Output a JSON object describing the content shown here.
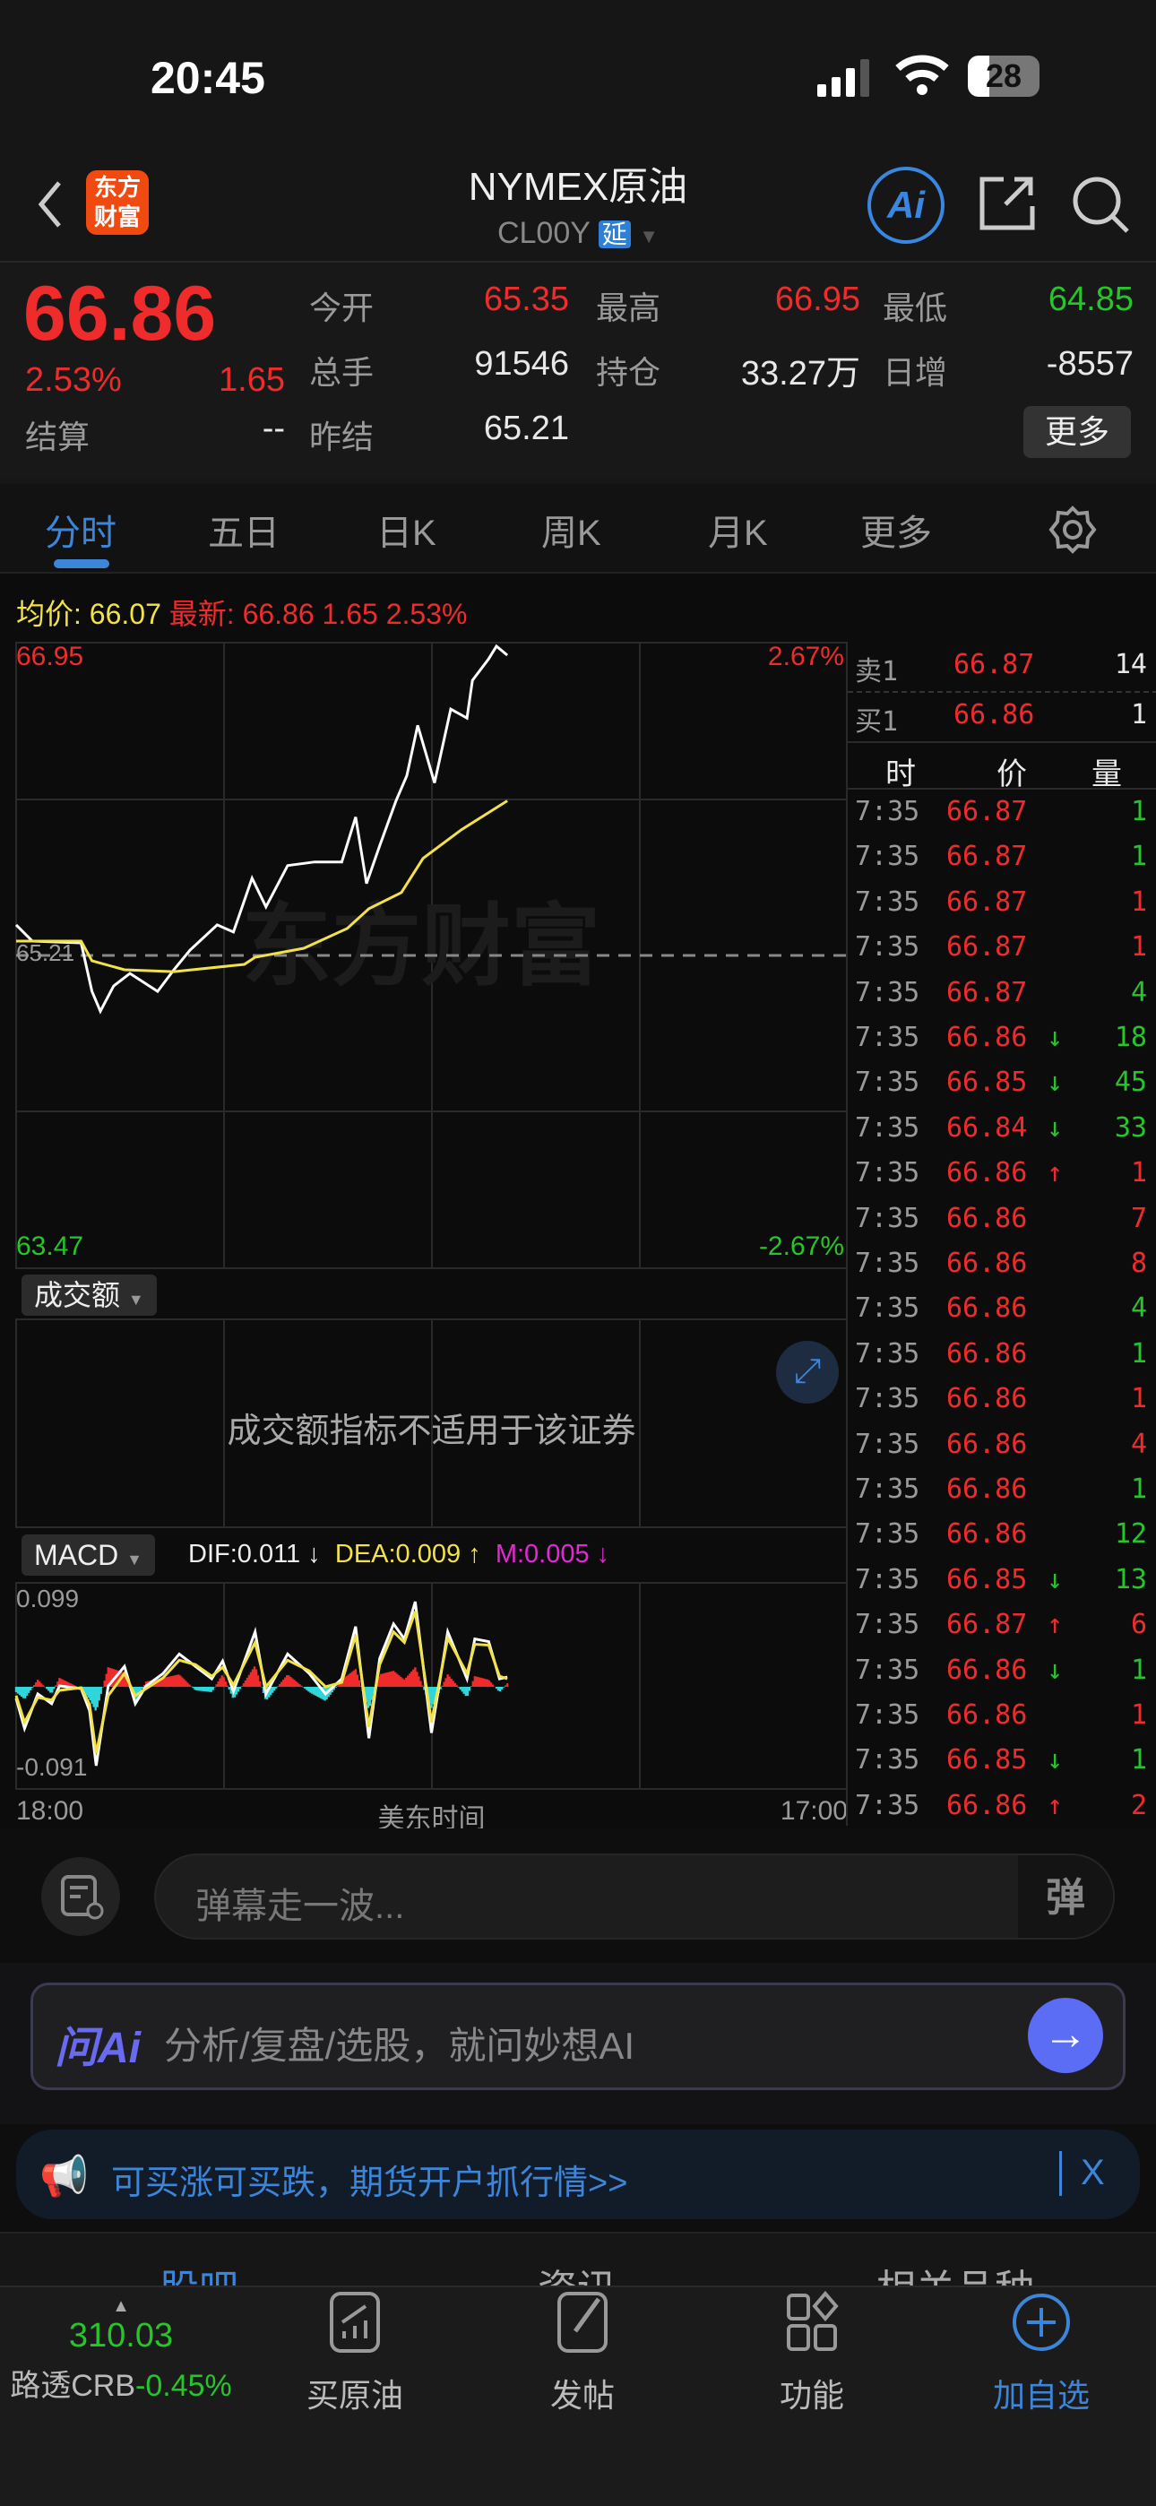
{
  "status": {
    "time": "20:45",
    "battery": "28"
  },
  "header": {
    "title": "NYMEX原油",
    "code": "CL00Y",
    "delay_badge": "延",
    "logo_text": "东方财富",
    "ai_label": "Ai"
  },
  "quote": {
    "price": "66.86",
    "change_pct": "2.53%",
    "change": "1.65",
    "fields": [
      {
        "label": "今开",
        "value": "65.35",
        "color": "red"
      },
      {
        "label": "最高",
        "value": "66.95",
        "color": "red"
      },
      {
        "label": "最低",
        "value": "64.85",
        "color": "green"
      },
      {
        "label": "总手",
        "value": "91546",
        "color": "white"
      },
      {
        "label": "持仓",
        "value": "33.27万",
        "color": "white"
      },
      {
        "label": "日增",
        "value": "-8557",
        "color": "white"
      },
      {
        "label": "结算",
        "value": "--",
        "color": "white"
      },
      {
        "label": "昨结",
        "value": "65.21",
        "color": "white"
      }
    ],
    "more_button": "更多"
  },
  "tabs": [
    "分时",
    "五日",
    "日K",
    "周K",
    "月K",
    "更多"
  ],
  "info_line": {
    "avg_label": "均价:",
    "avg": "66.07",
    "latest_label": "最新:",
    "latest": "66.86",
    "change": "1.65",
    "pct": "2.53%"
  },
  "volume_panel": {
    "selector": "成交额",
    "message": "成交额指标不适用于该证券"
  },
  "macd_panel": {
    "selector": "MACD",
    "dif": "DIF:0.011 ↓",
    "dea": "DEA:0.009 ↑",
    "m": "M:0.005 ↓"
  },
  "order_book": {
    "ask_label": "卖1",
    "ask_price": "66.87",
    "ask_vol": "14",
    "bid_label": "买1",
    "bid_price": "66.86",
    "bid_vol": "1",
    "headers": [
      "时",
      "价",
      "量"
    ]
  },
  "trades": [
    {
      "t": "7:35",
      "p": "66.87",
      "a": "",
      "v": "1",
      "vc": "g"
    },
    {
      "t": "7:35",
      "p": "66.87",
      "a": "",
      "v": "1",
      "vc": "g"
    },
    {
      "t": "7:35",
      "p": "66.87",
      "a": "",
      "v": "1",
      "vc": "r"
    },
    {
      "t": "7:35",
      "p": "66.87",
      "a": "",
      "v": "1",
      "vc": "r"
    },
    {
      "t": "7:35",
      "p": "66.87",
      "a": "",
      "v": "4",
      "vc": "g"
    },
    {
      "t": "7:35",
      "p": "66.86",
      "a": "↓",
      "v": "18",
      "vc": "g"
    },
    {
      "t": "7:35",
      "p": "66.85",
      "a": "↓",
      "v": "45",
      "vc": "g"
    },
    {
      "t": "7:35",
      "p": "66.84",
      "a": "↓",
      "v": "33",
      "vc": "g"
    },
    {
      "t": "7:35",
      "p": "66.86",
      "a": "↑",
      "v": "1",
      "vc": "r"
    },
    {
      "t": "7:35",
      "p": "66.86",
      "a": "",
      "v": "7",
      "vc": "r"
    },
    {
      "t": "7:35",
      "p": "66.86",
      "a": "",
      "v": "8",
      "vc": "r"
    },
    {
      "t": "7:35",
      "p": "66.86",
      "a": "",
      "v": "4",
      "vc": "g"
    },
    {
      "t": "7:35",
      "p": "66.86",
      "a": "",
      "v": "1",
      "vc": "g"
    },
    {
      "t": "7:35",
      "p": "66.86",
      "a": "",
      "v": "1",
      "vc": "r"
    },
    {
      "t": "7:35",
      "p": "66.86",
      "a": "",
      "v": "4",
      "vc": "r"
    },
    {
      "t": "7:35",
      "p": "66.86",
      "a": "",
      "v": "1",
      "vc": "g"
    },
    {
      "t": "7:35",
      "p": "66.86",
      "a": "",
      "v": "12",
      "vc": "g"
    },
    {
      "t": "7:35",
      "p": "66.85",
      "a": "↓",
      "v": "13",
      "vc": "g"
    },
    {
      "t": "7:35",
      "p": "66.87",
      "a": "↑",
      "v": "6",
      "vc": "r"
    },
    {
      "t": "7:35",
      "p": "66.86",
      "a": "↓",
      "v": "1",
      "vc": "g"
    },
    {
      "t": "7:35",
      "p": "66.86",
      "a": "",
      "v": "1",
      "vc": "r"
    },
    {
      "t": "7:35",
      "p": "66.85",
      "a": "↓",
      "v": "1",
      "vc": "g"
    },
    {
      "t": "7:35",
      "p": "66.86",
      "a": "↑",
      "v": "2",
      "vc": "r"
    }
  ],
  "danmaku": {
    "placeholder": "弹幕走一波...",
    "toggle": "弹"
  },
  "ai_box": {
    "brand": "问Ai",
    "placeholder": "分析/复盘/选股，就问妙想AI"
  },
  "banner": {
    "text": "可买涨可买跌，期货开户抓行情>>",
    "close": "X"
  },
  "sub_tabs": [
    "股吧",
    "资讯",
    "相关品种"
  ],
  "bottom_nav": {
    "index_value": "310.03",
    "index_name": "路透CRB",
    "index_change": "-0.45%",
    "items": [
      "买原油",
      "发帖",
      "功能",
      "加自选"
    ]
  },
  "colors": {
    "up": "#ef2b2b",
    "down": "#27c42b",
    "accent": "#3d85d8",
    "avg_line": "#f2e24a",
    "macd_m": "#e627d8"
  },
  "chart_data": [
    {
      "type": "line",
      "title": "分时",
      "xlabel": "美东时间",
      "x_ticks": [
        "18:00",
        "17:00"
      ],
      "x_range_minutes": [
        0,
        1380
      ],
      "ylim": [
        63.47,
        66.95
      ],
      "baseline": 65.21,
      "y_labels_left": [
        "66.95",
        "65.21",
        "63.47"
      ],
      "y_labels_right": [
        "2.67%",
        "-2.67%"
      ],
      "series": [
        {
          "name": "价格",
          "x": [
            0,
            27,
            108,
            126,
            140,
            162,
            189,
            235,
            262,
            289,
            334,
            361,
            392,
            415,
            451,
            496,
            541,
            564,
            582,
            604,
            631,
            649,
            667,
            695,
            722,
            749,
            758,
            785,
            798,
            816
          ],
          "values": [
            65.38,
            65.29,
            65.28,
            65.01,
            64.9,
            65.04,
            65.11,
            65.01,
            65.13,
            65.24,
            65.38,
            65.34,
            65.64,
            65.48,
            65.71,
            65.73,
            65.73,
            65.98,
            65.61,
            65.82,
            66.07,
            66.21,
            66.49,
            66.17,
            66.58,
            66.53,
            66.74,
            66.86,
            66.93,
            66.88
          ]
        },
        {
          "name": "均价",
          "x": [
            0,
            108,
            126,
            180,
            262,
            379,
            397,
            478,
            550,
            586,
            640,
            676,
            740,
            816
          ],
          "values": [
            65.29,
            65.29,
            65.18,
            65.13,
            65.12,
            65.16,
            65.2,
            65.25,
            65.36,
            65.47,
            65.56,
            65.75,
            65.91,
            66.07
          ]
        }
      ]
    },
    {
      "type": "line",
      "title": "MACD",
      "ylim": [
        -0.091,
        0.099
      ],
      "y_labels": [
        "0.099",
        "-0.091"
      ],
      "x": [
        0,
        14,
        36,
        59,
        72,
        108,
        122,
        133,
        153,
        180,
        198,
        216,
        244,
        271,
        298,
        325,
        343,
        361,
        397,
        415,
        451,
        487,
        514,
        541,
        564,
        586,
        604,
        627,
        645,
        663,
        690,
        717,
        749,
        762,
        785,
        803,
        816
      ],
      "series": [
        {
          "name": "DIF",
          "values": [
            -0.013,
            -0.047,
            -0.008,
            -0.019,
            0.001,
            -0.002,
            -0.027,
            -0.089,
            0.001,
            0.023,
            -0.019,
            0.001,
            0.015,
            0.037,
            0.023,
            0.009,
            0.029,
            -0.005,
            0.062,
            -0.008,
            0.037,
            0.015,
            -0.008,
            0.009,
            0.068,
            -0.058,
            0.032,
            0.071,
            0.054,
            0.096,
            -0.052,
            0.062,
            0.009,
            0.054,
            0.051,
            0.009,
            0.011
          ]
        },
        {
          "name": "DEA",
          "values": [
            -0.01,
            -0.04,
            -0.012,
            -0.015,
            -0.004,
            -0.001,
            -0.02,
            -0.075,
            -0.01,
            0.015,
            -0.01,
            -0.002,
            0.01,
            0.03,
            0.025,
            0.012,
            0.022,
            0.002,
            0.05,
            0.0,
            0.03,
            0.018,
            0.0,
            0.005,
            0.058,
            -0.045,
            0.025,
            0.062,
            0.05,
            0.085,
            -0.04,
            0.055,
            0.015,
            0.048,
            0.047,
            0.012,
            0.009
          ]
        }
      ]
    }
  ]
}
